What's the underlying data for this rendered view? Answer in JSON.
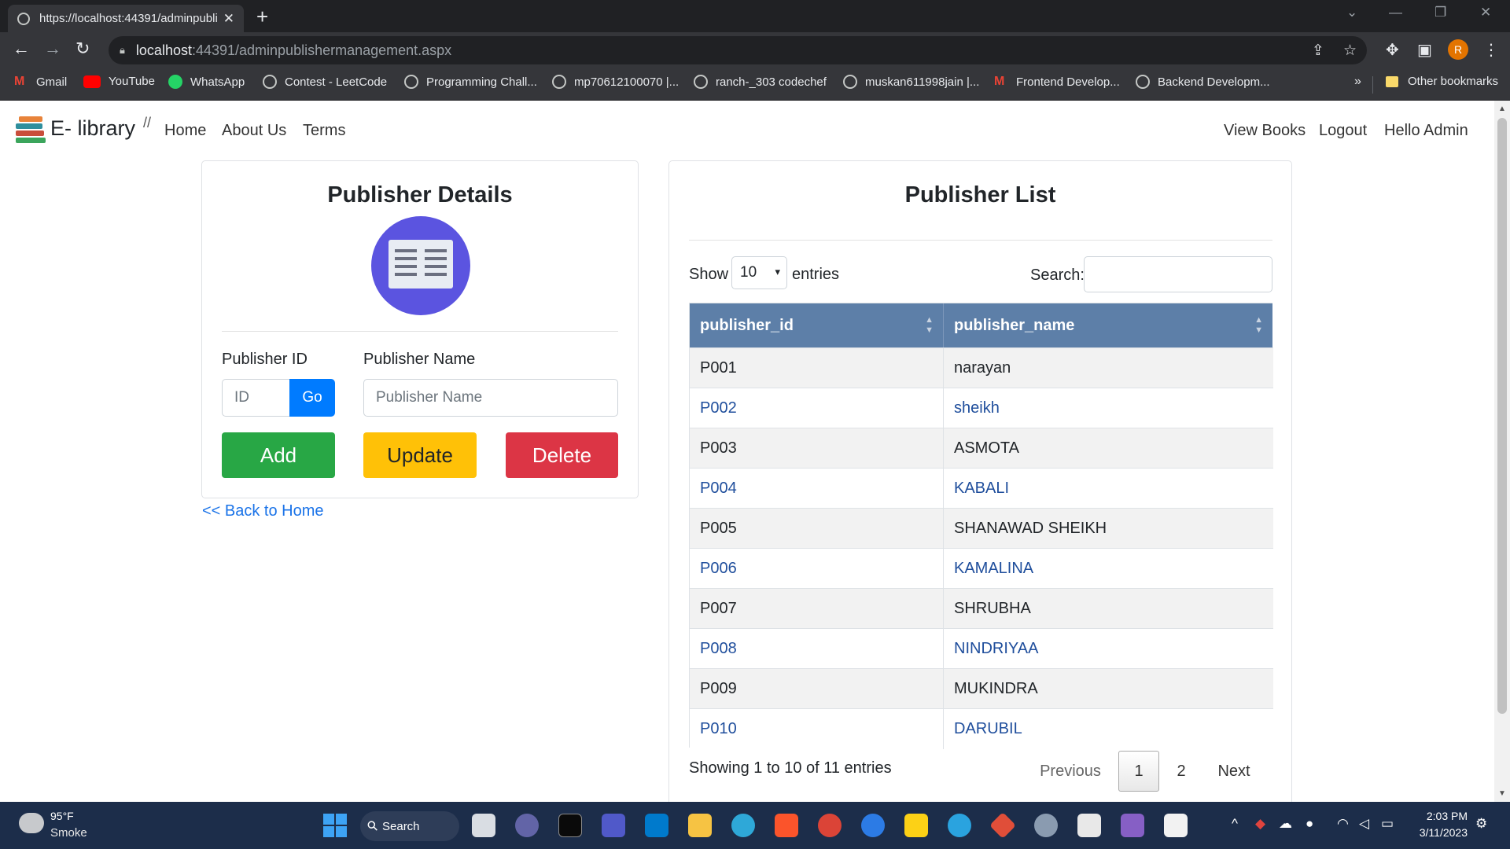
{
  "browser": {
    "tab_title": "https://localhost:44391/adminpublishermanagement.aspx",
    "url_host": "localhost",
    "url_rest": ":44391/adminpublishermanagement.aspx",
    "avatar_letter": "R",
    "bookmarks": [
      {
        "label": "Gmail",
        "icon": "gmail-icon"
      },
      {
        "label": "YouTube",
        "icon": "youtube-icon"
      },
      {
        "label": "WhatsApp",
        "icon": "whatsapp-icon"
      },
      {
        "label": "Contest - LeetCode",
        "icon": "globe-icon"
      },
      {
        "label": "Programming Chall...",
        "icon": "globe-icon"
      },
      {
        "label": "mp70612100070 |...",
        "icon": "globe-icon"
      },
      {
        "label": "ranch-_303 codechef",
        "icon": "globe-icon"
      },
      {
        "label": "muskan611998jain |...",
        "icon": "globe-icon"
      },
      {
        "label": "Frontend Develop...",
        "icon": "gmail-icon"
      },
      {
        "label": "Backend Developm...",
        "icon": "globe-icon"
      }
    ],
    "more_bookmarks": "»",
    "other_bookmarks": "Other bookmarks"
  },
  "nav": {
    "brand": "E- library",
    "slash": "//",
    "links": [
      "Home",
      "About Us",
      "Terms"
    ],
    "right_links": [
      "View Books",
      "Logout",
      "Hello Admin"
    ]
  },
  "details": {
    "title": "Publisher Details",
    "id_label": "Publisher ID",
    "name_label": "Publisher Name",
    "id_placeholder": "ID",
    "go_label": "Go",
    "name_placeholder": "Publisher Name",
    "add_label": "Add",
    "update_label": "Update",
    "delete_label": "Delete",
    "back_link": "<< Back to Home"
  },
  "list": {
    "title": "Publisher List",
    "show_label": "Show",
    "entries_value": "10",
    "entries_label": "entries",
    "search_label": "Search:",
    "columns": [
      "publisher_id",
      "publisher_name"
    ],
    "rows": [
      {
        "id": "P001",
        "name": "narayan"
      },
      {
        "id": "P002",
        "name": "sheikh"
      },
      {
        "id": "P003",
        "name": "ASMOTA"
      },
      {
        "id": "P004",
        "name": "KABALI"
      },
      {
        "id": "P005",
        "name": "SHANAWAD SHEIKH"
      },
      {
        "id": "P006",
        "name": "KAMALINA"
      },
      {
        "id": "P007",
        "name": "SHRUBHA"
      },
      {
        "id": "P008",
        "name": "NINDRIYAA"
      },
      {
        "id": "P009",
        "name": "MUKINDRA"
      },
      {
        "id": "P010",
        "name": "DARUBIL"
      }
    ],
    "info": "Showing 1 to 10 of 11 entries",
    "prev": "Previous",
    "pages": [
      "1",
      "2"
    ],
    "next": "Next"
  },
  "taskbar": {
    "temp": "95°F",
    "weather": "Smoke",
    "search": "Search",
    "time": "2:03 PM",
    "date": "3/11/2023"
  },
  "colors": {
    "add": "#28a745",
    "update": "#ffc107",
    "delete": "#dc3545",
    "go": "#007bff",
    "table_header": "#5d7fa8"
  }
}
